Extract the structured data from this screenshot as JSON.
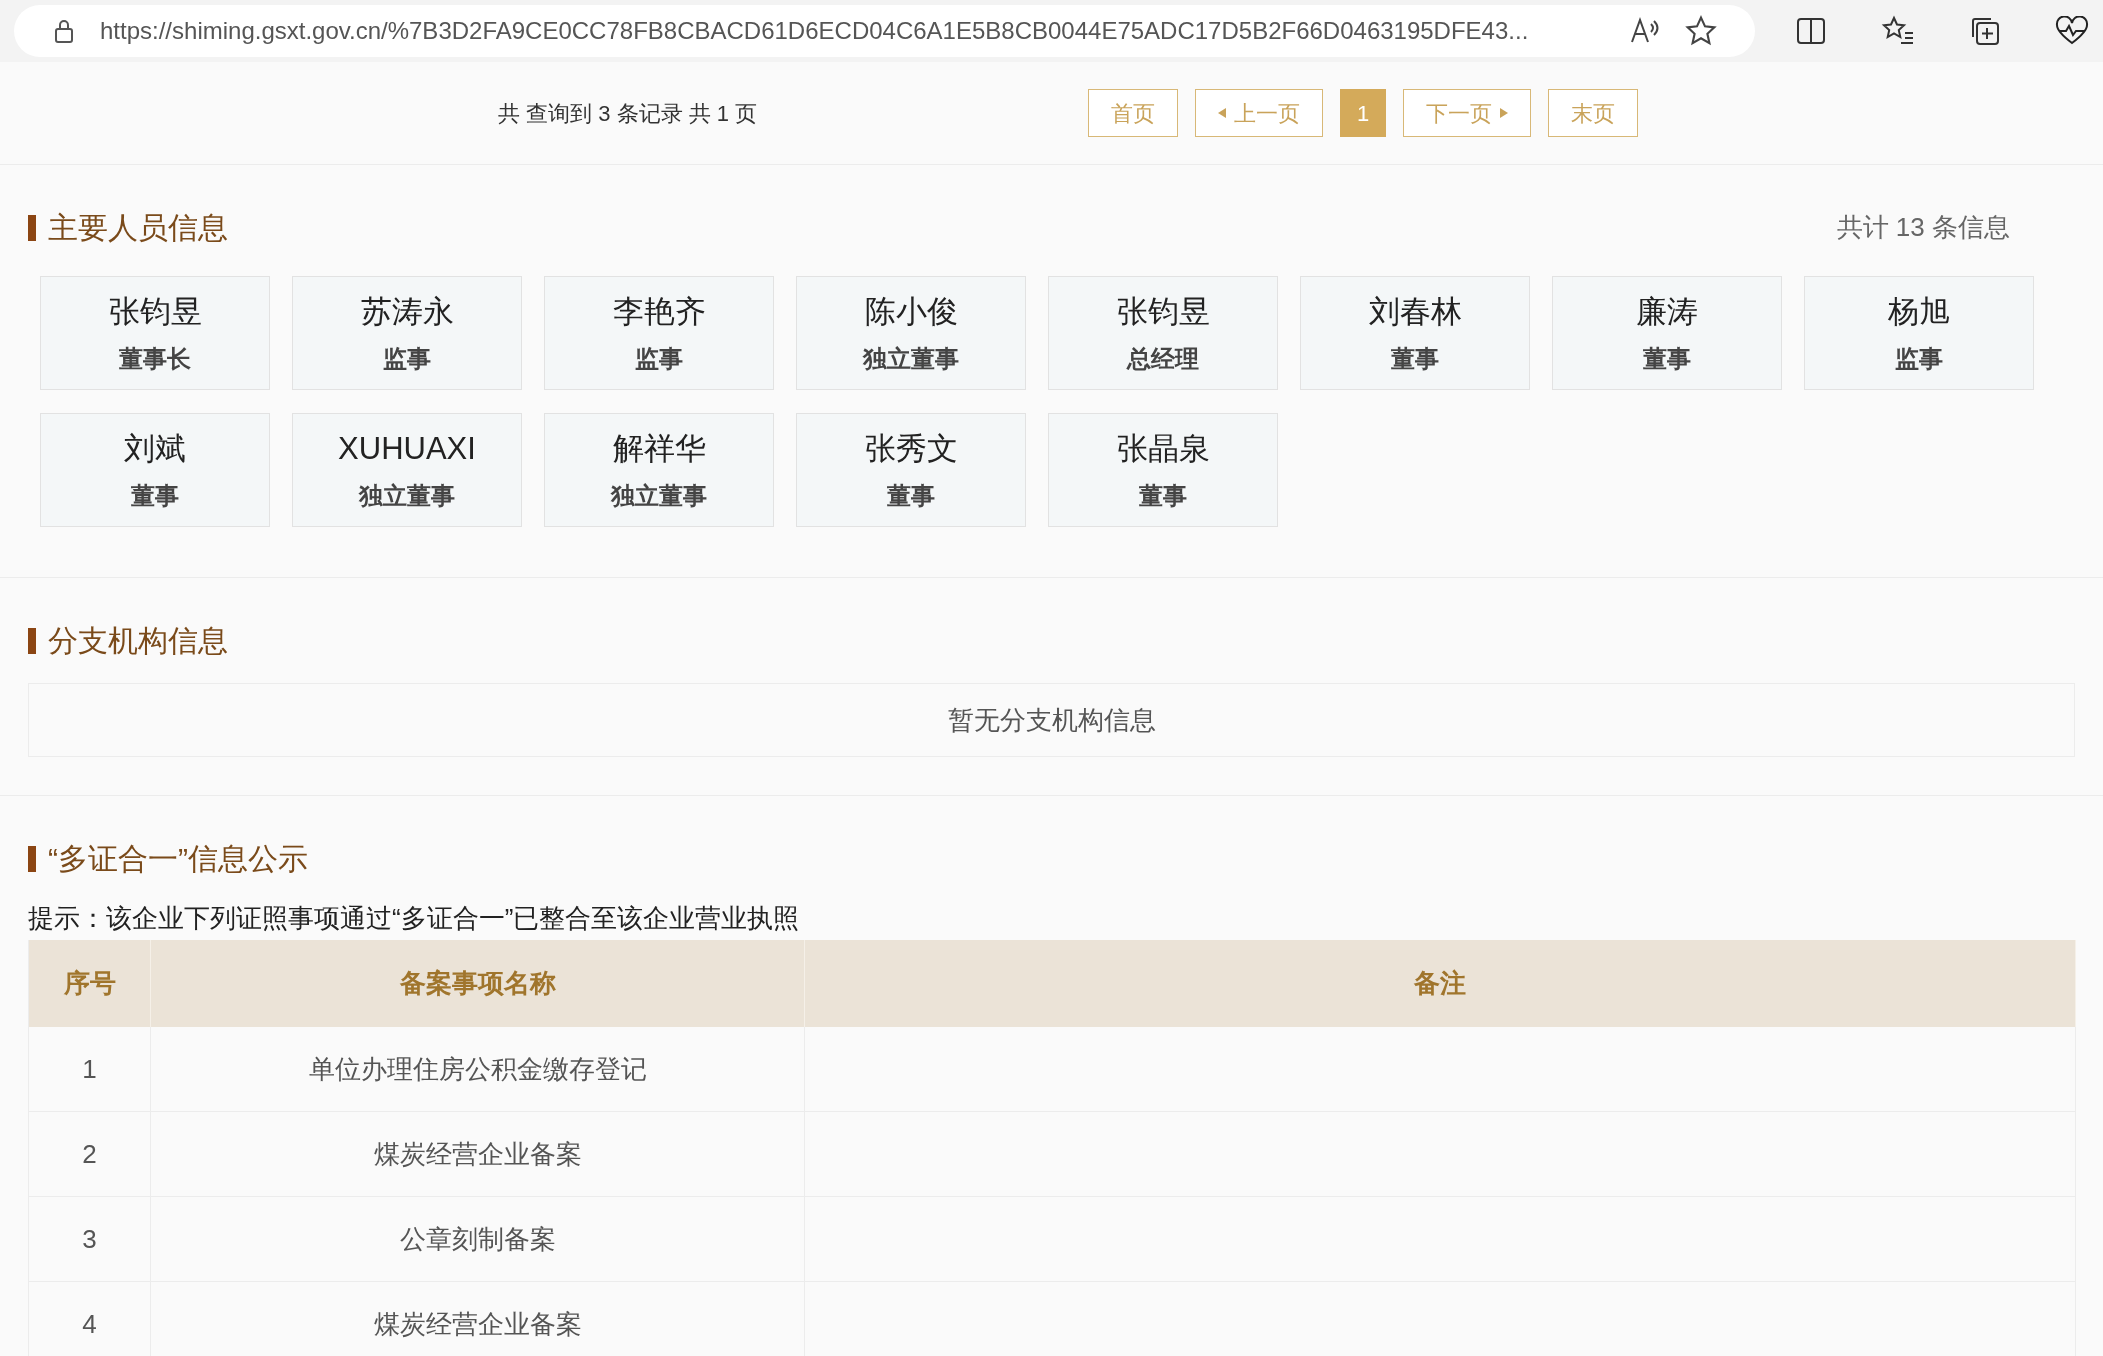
{
  "browser": {
    "url": "https://shiming.gsxt.gov.cn/%7B3D2FA9CE0CC78FB8CBACD61D6ECD04C6A1E5B8CB0044E75ADC17D5B2F66D0463195DFE43..."
  },
  "pagination": {
    "summary": "共 查询到 3 条记录 共 1 页",
    "buttons": [
      {
        "label": "首页",
        "kind": "plain",
        "selected": false
      },
      {
        "label": "上一页",
        "kind": "prev",
        "selected": false
      },
      {
        "label": "1",
        "kind": "plain",
        "selected": true
      },
      {
        "label": "下一页",
        "kind": "next",
        "selected": false
      },
      {
        "label": "末页",
        "kind": "plain",
        "selected": false
      }
    ]
  },
  "key_personnel": {
    "title": "主要人员信息",
    "count": "共计 13 条信息",
    "people": [
      {
        "name": "张钧昱",
        "role": "董事长"
      },
      {
        "name": "苏涛永",
        "role": "监事"
      },
      {
        "name": "李艳齐",
        "role": "监事"
      },
      {
        "name": "陈小俊",
        "role": "独立董事"
      },
      {
        "name": "张钧昱",
        "role": "总经理"
      },
      {
        "name": "刘春林",
        "role": "董事"
      },
      {
        "name": "廉涛",
        "role": "董事"
      },
      {
        "name": "杨旭",
        "role": "监事"
      },
      {
        "name": "刘斌",
        "role": "董事"
      },
      {
        "name": "XUHUAXI",
        "role": "独立董事"
      },
      {
        "name": "解祥华",
        "role": "独立董事"
      },
      {
        "name": "张秀文",
        "role": "董事"
      },
      {
        "name": "张晶泉",
        "role": "董事"
      }
    ]
  },
  "branches": {
    "title": "分支机构信息",
    "empty_text": "暂无分支机构信息"
  },
  "multi_cert": {
    "title": "“多证合一”信息公示",
    "hint": "提示：该企业下列证照事项通过“多证合一”已整合至该企业营业执照",
    "table": {
      "columns": [
        "序号",
        "备案事项名称",
        "备注"
      ],
      "rows": [
        [
          "1",
          "单位办理住房公积金缴存登记"
        ],
        [
          "2",
          "煤炭经营企业备案"
        ],
        [
          "3",
          "公章刻制备案"
        ],
        [
          "4",
          "煤炭经营企业备案"
        ]
      ]
    }
  }
}
